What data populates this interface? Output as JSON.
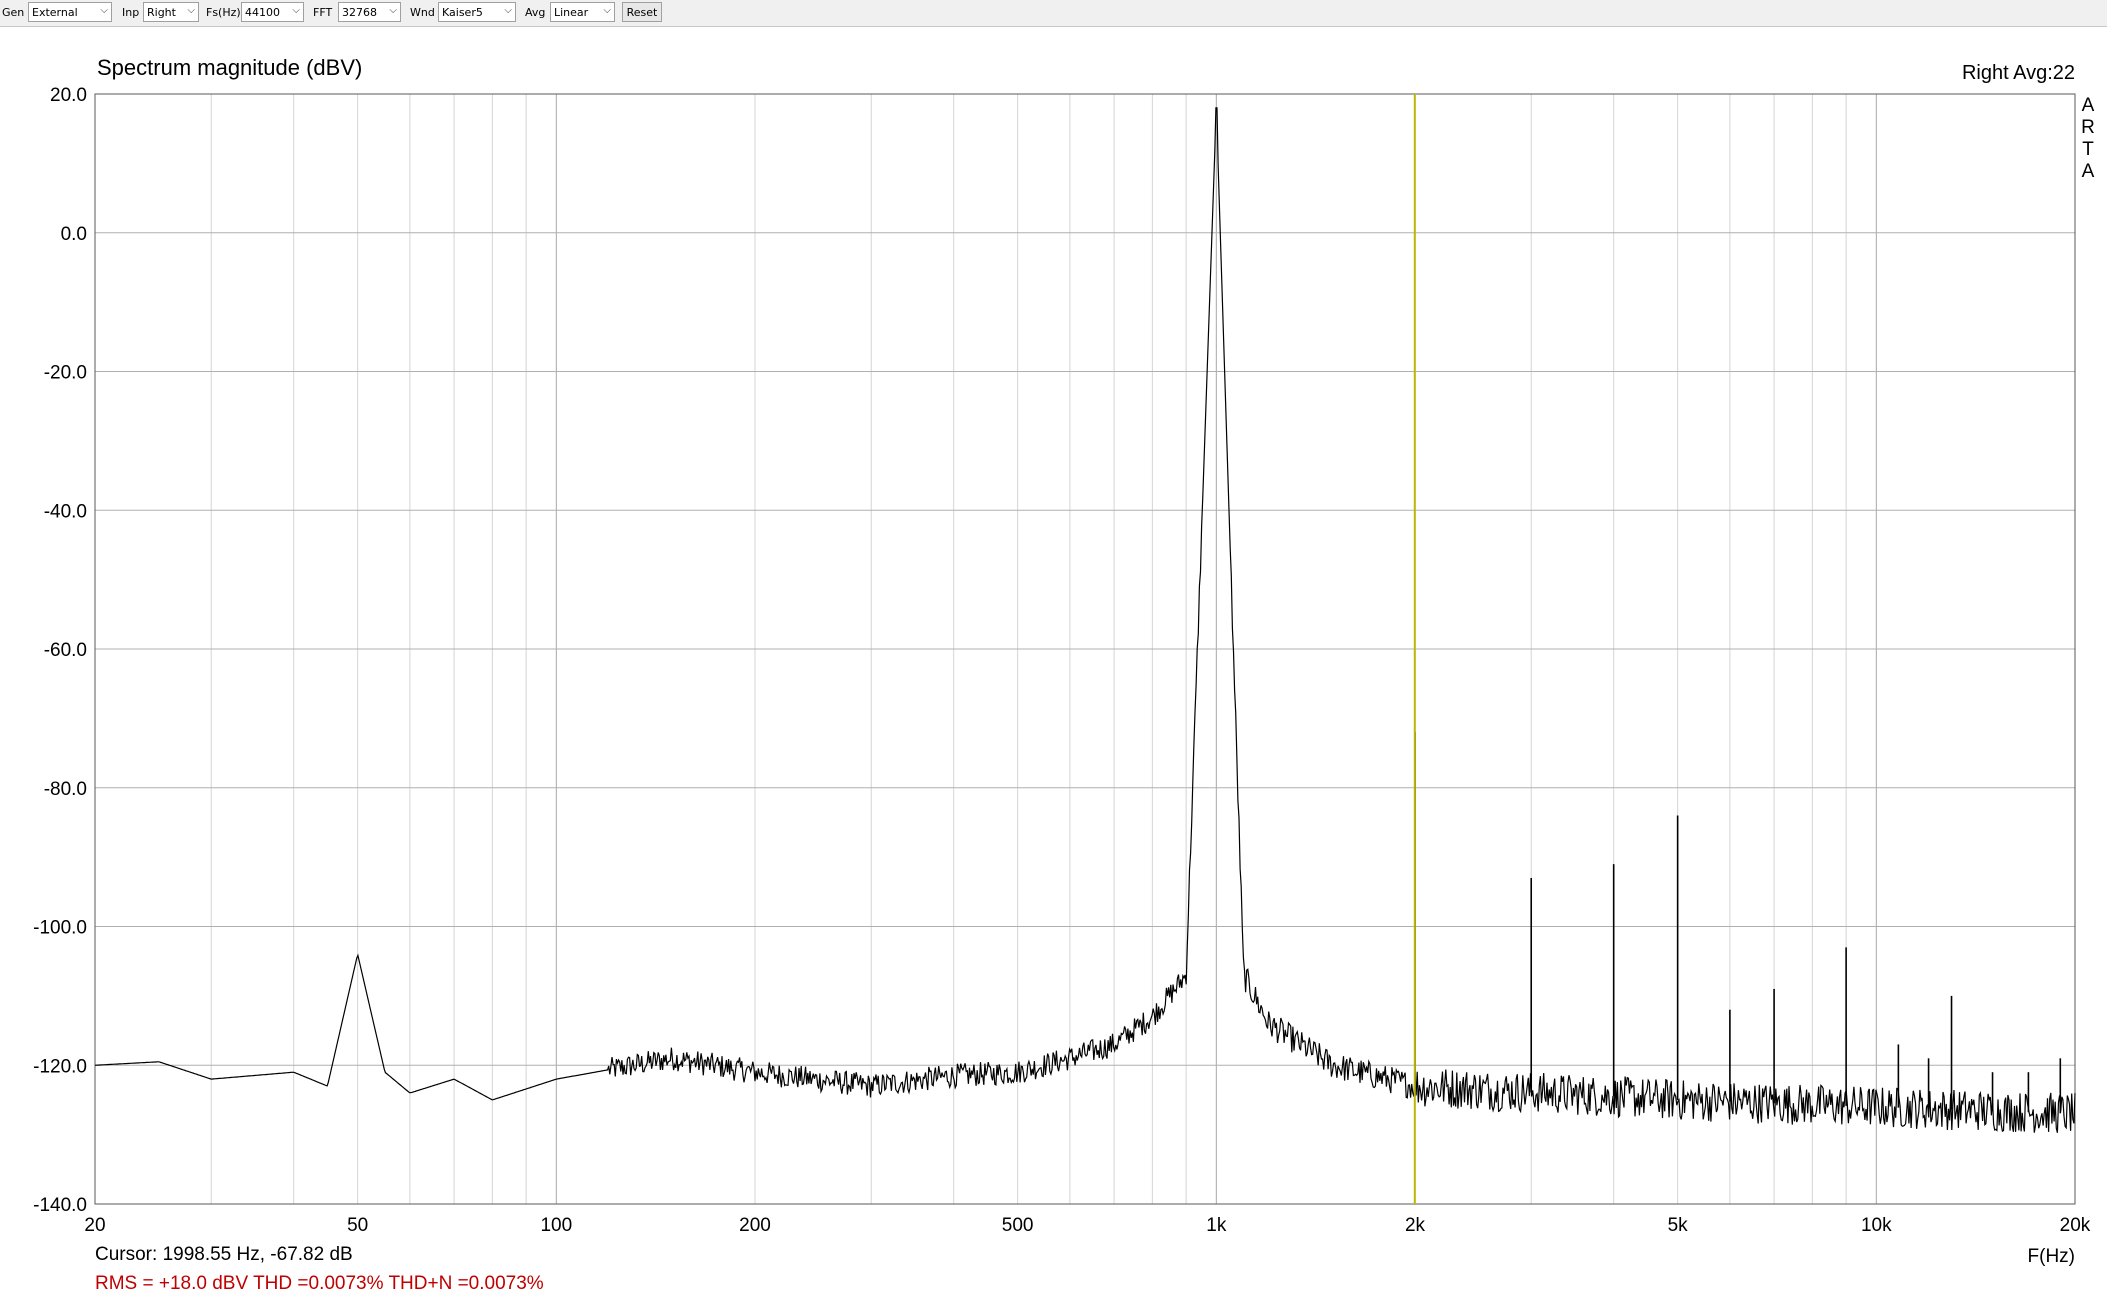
{
  "toolbar": {
    "gen": {
      "label": "Gen",
      "value": "External"
    },
    "inp": {
      "label": "Inp",
      "value": "Right"
    },
    "fs": {
      "label": "Fs(Hz)",
      "value": "44100"
    },
    "fft": {
      "label": "FFT",
      "value": "32768"
    },
    "wnd": {
      "label": "Wnd",
      "value": "Kaiser5"
    },
    "avg": {
      "label": "Avg",
      "value": "Linear"
    },
    "reset_label": "Reset"
  },
  "chart_data": {
    "type": "line",
    "title": "Spectrum magnitude (dBV)",
    "channel_info": "Right  Avg:22",
    "watermark": "ARTA",
    "xlabel": "F(Hz)",
    "x_scale": "log",
    "xlim": [
      20,
      20000
    ],
    "ylim": [
      -140,
      20
    ],
    "x_tick_values": [
      20,
      50,
      100,
      200,
      500,
      1000,
      2000,
      5000,
      10000,
      20000
    ],
    "x_tick_labels": [
      "20",
      "50",
      "100",
      "200",
      "500",
      "1k",
      "2k",
      "5k",
      "10k",
      "20k"
    ],
    "y_tick_values": [
      20,
      0,
      -20,
      -40,
      -60,
      -80,
      -100,
      -120,
      -140
    ],
    "y_tick_labels": [
      "20.0",
      "0.0",
      "-20.0",
      "-40.0",
      "-60.0",
      "-80.0",
      "-100.0",
      "-120.0",
      "-140.0"
    ],
    "grid": true,
    "cursor": {
      "freq": 1998.55,
      "level": -67.82,
      "text": "Cursor: 1998.55 Hz, -67.82 dB"
    },
    "status_text": "RMS =  +18.0 dBV  THD =0.0073%  THD+N =0.0073%",
    "series": [
      {
        "line_color": "#000000",
        "noise_floor": [
          [
            20,
            -120
          ],
          [
            25,
            -119.5
          ],
          [
            30,
            -122
          ],
          [
            40,
            -121
          ],
          [
            45,
            -123
          ],
          [
            50,
            -104
          ],
          [
            55,
            -121
          ],
          [
            60,
            -124
          ],
          [
            70,
            -122
          ],
          [
            80,
            -125
          ],
          [
            100,
            -122
          ],
          [
            150,
            -119
          ],
          [
            200,
            -121
          ],
          [
            300,
            -123
          ],
          [
            400,
            -121.5
          ],
          [
            500,
            -121
          ],
          [
            600,
            -119
          ],
          [
            700,
            -117
          ],
          [
            800,
            -113
          ],
          [
            900,
            -107
          ],
          [
            1000,
            18
          ],
          [
            1100,
            -107
          ],
          [
            1200,
            -114
          ],
          [
            1500,
            -120
          ],
          [
            2000,
            -123
          ],
          [
            5000,
            -125
          ],
          [
            10000,
            -126
          ],
          [
            20000,
            -127
          ]
        ],
        "harmonics": [
          [
            1000,
            18.0
          ],
          [
            2000,
            -72
          ],
          [
            3000,
            -93
          ],
          [
            4000,
            -91
          ],
          [
            5000,
            -84
          ],
          [
            6000,
            -112
          ],
          [
            7000,
            -109
          ],
          [
            9000,
            -103
          ],
          [
            10800,
            -117
          ],
          [
            12000,
            -119
          ],
          [
            13000,
            -110
          ],
          [
            15000,
            -121
          ],
          [
            17000,
            -121
          ],
          [
            19000,
            -119
          ]
        ]
      }
    ]
  },
  "colors": {
    "trace": "#000000",
    "cursor_line": "#b8b800",
    "grid": "#c0c0c0",
    "status_text": "#c00000"
  }
}
